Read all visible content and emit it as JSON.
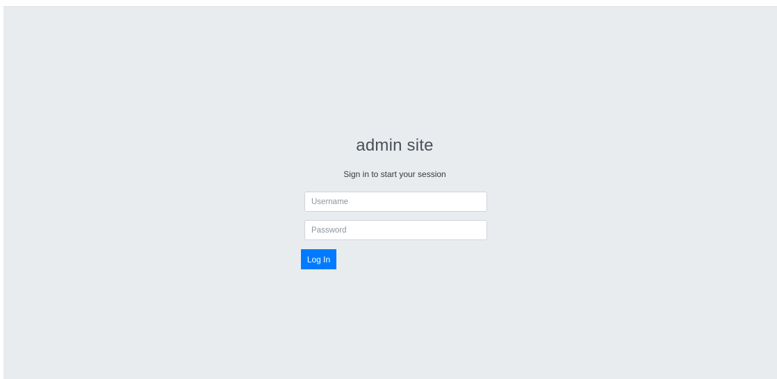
{
  "login": {
    "title": "admin site",
    "subtitle": "Sign in to start your session",
    "username": {
      "value": "",
      "placeholder": "Username"
    },
    "password": {
      "value": "",
      "placeholder": "Password"
    },
    "submit_label": "Log In"
  },
  "colors": {
    "background": "#e9ecef",
    "primary_button": "#007bff",
    "input_border": "#ced4da"
  }
}
